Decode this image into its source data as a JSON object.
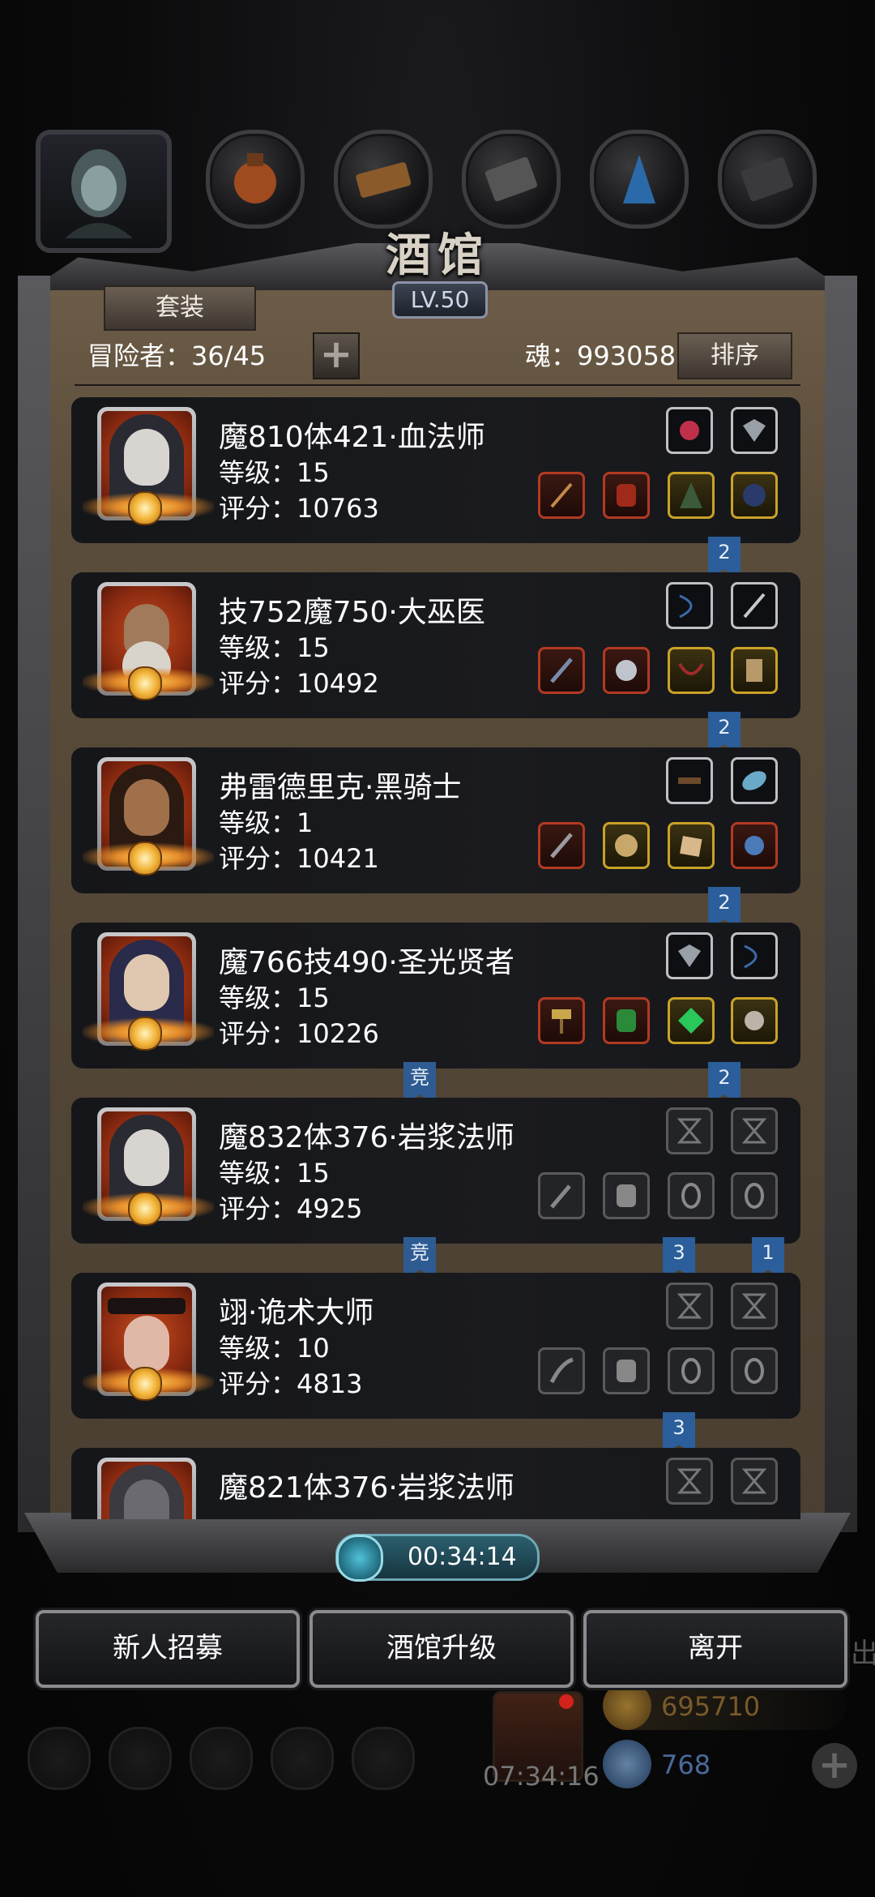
{
  "tavern": {
    "title": "酒馆",
    "level": "LV.50",
    "suit_button": "套装",
    "adventurers_label": "冒险者：36/45",
    "souls_label": "魂：993058",
    "sort_button": "排序"
  },
  "heroes": [
    {
      "name": "魔810体421·血法师",
      "level": "等级：15",
      "score": "评分：10763"
    },
    {
      "name": "技752魔750·大巫医",
      "level": "等级：15",
      "score": "评分：10492"
    },
    {
      "name": "弗雷德里克·黑骑士",
      "level": "等级：1",
      "score": "评分：10421"
    },
    {
      "name": "魔766技490·圣光贤者",
      "level": "等级：15",
      "score": "评分：10226"
    },
    {
      "name": "魔832体376·岩浆法师",
      "level": "等级：15",
      "score": "评分：4925"
    },
    {
      "name": "翊·诡术大师",
      "level": "等级：10",
      "score": "评分：4813"
    },
    {
      "name": "魔821体376·岩浆法师",
      "level": "",
      "score": ""
    }
  ],
  "ribbons": {
    "r1": "2",
    "r2": "2",
    "r3": "2",
    "r4a": "竞",
    "r4b": "2",
    "r5a": "竞",
    "r5b": "3",
    "r5c": "1",
    "r6": "3"
  },
  "timer": "00:34:14",
  "buttons": {
    "recruit": "新人招募",
    "upgrade": "酒馆升级",
    "leave": "离开"
  },
  "background": {
    "out_text": "出",
    "clock": "07:34:16",
    "gold": "695710",
    "gems": "768"
  },
  "colors": {
    "rarity_red": "#b23a22",
    "rarity_gold": "#c9a227",
    "ribbon_blue": "#2b5e9a"
  }
}
